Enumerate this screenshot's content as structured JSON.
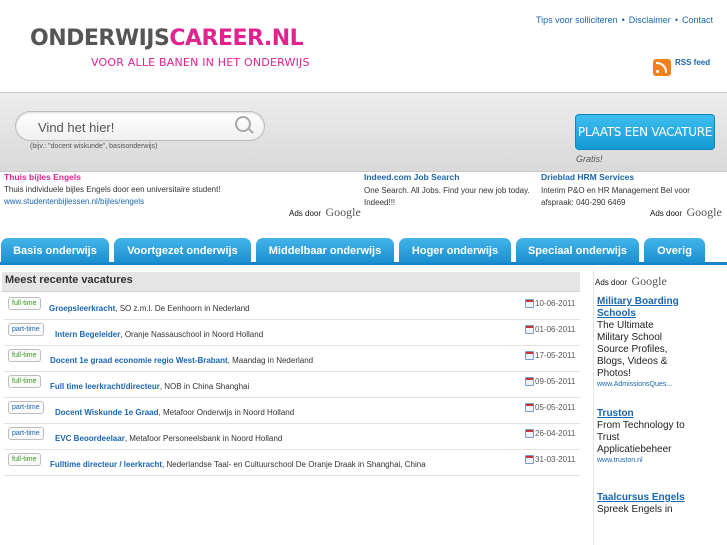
{
  "header": {
    "logo_part1": "ONDERWIJS",
    "logo_part2": "CAREER.NL",
    "tagline": "VOOR ALLE BANEN IN HET ONDERWIJS",
    "top_links": [
      "Tips voor solliciteren",
      "Disclaimer",
      "Contact"
    ],
    "rss_label": "RSS feed"
  },
  "search": {
    "placeholder": "Vind het hier!",
    "hint": "(bijv.: \"docent wiskunde\", basisonderwijs)",
    "post_button": "PLAATS EEN VACATURE",
    "gratis": "Gratis!"
  },
  "ad_strip": {
    "left": {
      "title": "Thuis bijles Engels",
      "body": "Thuis individuele bijles Engels door een universitaire student!",
      "url": "www.studentenbijlessen.nl/bijles/engels"
    },
    "middle": {
      "title": "Indeed.com Job Search",
      "body": "One Search. All Jobs. Find your new job today. Indeed!!!"
    },
    "right": {
      "title": "Drieblad HRM Services",
      "body": "Interim P&O en HR Management Bel voor afspraak: 040-290 6469"
    },
    "ads_by": "Ads door",
    "google": "Google"
  },
  "tabs": [
    "Basis onderwijs",
    "Voortgezet onderwijs",
    "Middelbaar onderwijs",
    "Hoger onderwijs",
    "Speciaal onderwijs",
    "Overig"
  ],
  "list": {
    "title": "Meest recente vacatures",
    "rows": [
      {
        "type": "full-time",
        "title": "Groepsleerkracht",
        "org": "SO z.m.l. De Eenhoorn",
        "in": "in",
        "location": "Nederland",
        "date": "10-06-2011"
      },
      {
        "type": "part-time",
        "title": "Intern Begeleider",
        "org": "Oranje Nassauschool",
        "in": "in",
        "location": "Noord Holland",
        "date": "01-06-2011"
      },
      {
        "type": "full-time",
        "title": "Docent 1e graad economie regio West-Brabant",
        "org": "Maandag",
        "in": "in",
        "location": "Nederland",
        "date": "17-05-2011"
      },
      {
        "type": "full-time",
        "title": "Full time leerkracht/directeur",
        "org": "NOB",
        "in": "in",
        "location": "China Shanghai",
        "date": "09-05-2011"
      },
      {
        "type": "part-time",
        "title": "Docent Wiskunde 1e Graad",
        "org": "Metafoor Onderwijs",
        "in": "in",
        "location": "Noord Holland",
        "date": "05-05-2011"
      },
      {
        "type": "part-time",
        "title": "EVC Beoordeelaar",
        "org": "Metafoor Personeelsbank",
        "in": "in",
        "location": "Noord Holland",
        "date": "26-04-2011"
      },
      {
        "type": "full-time",
        "title": "Fulltime directeur / leerkracht",
        "org": "Nederlandse Taal- en Cultuurschool De Oranje Draak",
        "in": "in",
        "location": "Shanghai, China",
        "date": "31-03-2011"
      }
    ]
  },
  "ads_right": {
    "ads_by": "Ads door",
    "google": "Google",
    "items": [
      {
        "title": "Military Boarding Schools",
        "body": "The Ultimate Military School Source Profiles, Blogs, Videos & Photos!",
        "url": "www.AdmissionsQues..."
      },
      {
        "title": "Truston",
        "body": "From Technology to Trust Applicatiebeheer",
        "url": "www.truston.nl"
      },
      {
        "title": "Taalcursus Engels",
        "body": "Spreek Engels in"
      }
    ]
  },
  "colors": {
    "brand_pink": "#e0238f",
    "brand_gray": "#555555",
    "tab_blue": "#1a8fcf",
    "link_blue": "#1a66b3",
    "full_time_green": "#3a9a1e"
  }
}
